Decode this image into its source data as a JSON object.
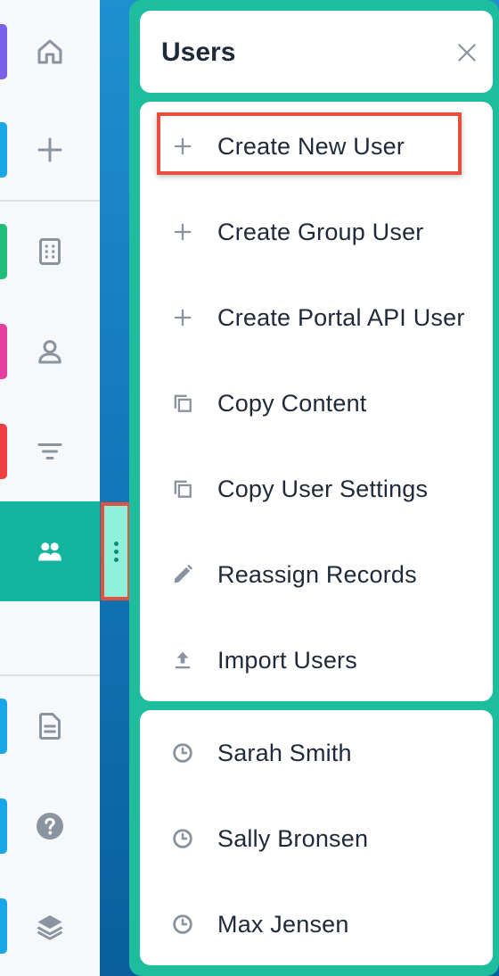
{
  "sidebar": {
    "items": [
      {
        "name": "home",
        "icon": "home-icon",
        "stripe": "#7b61e8"
      },
      {
        "name": "create",
        "icon": "plus-icon",
        "stripe": "#19a7e8"
      },
      {
        "name": "accounts",
        "icon": "building-icon",
        "stripe": "#1fbf7b"
      },
      {
        "name": "contacts",
        "icon": "person-icon",
        "stripe": "#e63ea0"
      },
      {
        "name": "filters",
        "icon": "filter-icon",
        "stripe": "#ef3f45"
      },
      {
        "name": "users",
        "icon": "users-icon",
        "active": true
      },
      {
        "name": "documents",
        "icon": "document-icon",
        "stripe": "#19a7e8"
      },
      {
        "name": "help",
        "icon": "help-icon",
        "stripe": "#19a7e8"
      },
      {
        "name": "layers",
        "icon": "layers-icon",
        "stripe": "#19a7e8"
      }
    ]
  },
  "panel": {
    "title": "Users",
    "close_icon": "close-icon",
    "menu": [
      {
        "label": "Create New User",
        "icon": "plus-icon"
      },
      {
        "label": "Create Group User",
        "icon": "plus-icon"
      },
      {
        "label": "Create Portal API User",
        "icon": "plus-icon"
      },
      {
        "label": "Copy Content",
        "icon": "copy-icon"
      },
      {
        "label": "Copy User Settings",
        "icon": "copy-icon"
      },
      {
        "label": "Reassign Records",
        "icon": "pencil-icon"
      },
      {
        "label": "Import Users",
        "icon": "upload-icon"
      }
    ],
    "recent": [
      {
        "label": "Sarah Smith",
        "icon": "clock-icon"
      },
      {
        "label": "Sally Bronsen",
        "icon": "clock-icon"
      },
      {
        "label": "Max Jensen",
        "icon": "clock-icon"
      }
    ]
  },
  "colors": {
    "accent": "#1ebd9e",
    "highlight": "#e6503c",
    "text": "#1e2a3a",
    "icon": "#8a93a0"
  }
}
